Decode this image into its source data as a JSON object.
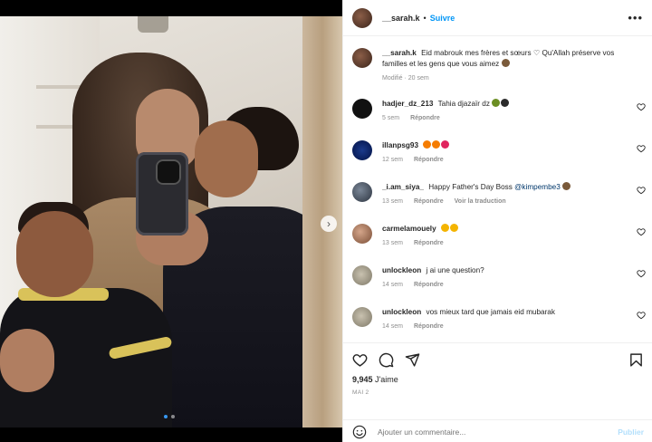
{
  "header": {
    "username": "__sarah.k",
    "separator": "•",
    "follow_label": "Suivre",
    "more_label": "•••"
  },
  "caption": {
    "username": "__sarah.k",
    "text": "Eid mabrouk mes frères et sœurs ♡ Qu'Allah préserve vos familles et les gens que vous aimez",
    "meta": "Modifié · 20 sem"
  },
  "comments": [
    {
      "username": "hadjer_dz_213",
      "text": "Tahia djazaïr dz",
      "age": "5 sem",
      "reply": "Répondre"
    },
    {
      "username": "illanpsg93",
      "text": "",
      "age": "12 sem",
      "reply": "Répondre"
    },
    {
      "username": "_i.am_siya_",
      "text": "Happy Father's Day Boss",
      "mention": "@kimpembe3",
      "age": "13 sem",
      "reply": "Répondre",
      "translate": "Voir la traduction"
    },
    {
      "username": "carmelamouely",
      "text": "",
      "age": "13 sem",
      "reply": "Répondre"
    },
    {
      "username": "unlockleon",
      "text": "j ai une question?",
      "age": "14 sem",
      "reply": "Répondre"
    },
    {
      "username": "unlockleon",
      "text": "vos mieux tard que jamais eid mubarak",
      "age": "14 sem",
      "reply": "Répondre"
    }
  ],
  "actions": {
    "likes_count": "9,945",
    "likes_label": "J'aime",
    "date": "MAI 2",
    "comment_placeholder": "Ajouter un commentaire...",
    "post_label": "Publier"
  },
  "carousel": {
    "next_label": "›",
    "slides": 2,
    "active_slide": 1
  },
  "colors": {
    "link_blue": "#0095f6",
    "mention_blue": "#00376b",
    "post_disabled": "#b2dffc",
    "active_dot": "#3797f0"
  }
}
